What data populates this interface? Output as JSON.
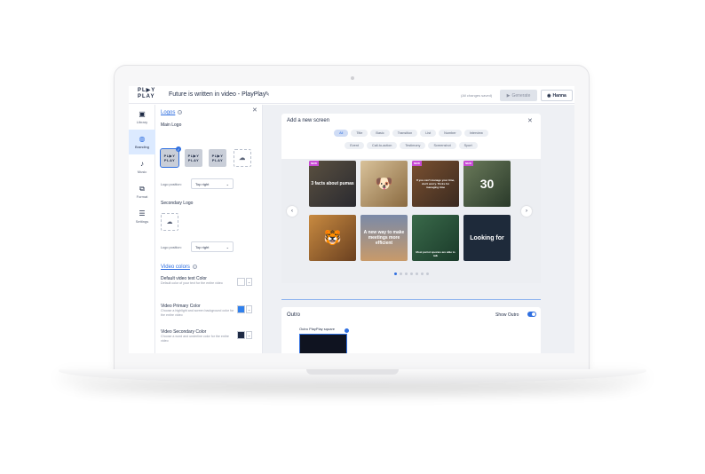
{
  "topbar": {
    "logo_top": "PL▶Y",
    "logo_bottom": "PLAY",
    "project_title": "Future is written in video - PlayPlay",
    "save_status": "(All changes saved)",
    "generate_label": "Generate",
    "user_name": "Hanna"
  },
  "nav": {
    "items": [
      {
        "label": "Library",
        "icon": "library-icon"
      },
      {
        "label": "Branding",
        "icon": "palette-icon"
      },
      {
        "label": "Music",
        "icon": "music-note-icon"
      },
      {
        "label": "Format",
        "icon": "format-icon"
      },
      {
        "label": "Settings",
        "icon": "sliders-icon"
      }
    ],
    "active": "Branding"
  },
  "panel": {
    "logos_title": "Logos",
    "main_logo_label": "Main Logo",
    "logo_tile_text": "PL▶Y PLAY",
    "logo_position_label": "Logo position:",
    "logo_position_value": "Top right",
    "secondary_logo_label": "Secondary Logo",
    "secondary_position_label": "Logo position:",
    "secondary_position_value": "Top right",
    "video_colors_title": "Video colors",
    "default_text_color_label": "Default video text Color",
    "default_text_color_desc": "Default color of your text for the entire video",
    "default_text_color": "#ffffff",
    "primary_color_label": "Video Primary Color",
    "primary_color_desc": "Choose a highlight and screen background color for the entire video",
    "primary_color": "#2f80ed",
    "secondary_color_label": "Video Secondary Color",
    "secondary_color_desc": "Choose a word and underline color for the entire video",
    "secondary_color": "#1e2a44"
  },
  "add_screen": {
    "title": "Add a new screen",
    "chips_row1": [
      "All",
      "Title",
      "Basic",
      "Transition",
      "List",
      "Number",
      "Interview"
    ],
    "chips_row2": [
      "Event",
      "Call-to-action",
      "Testimony",
      "Screenshot",
      "Sport"
    ],
    "active_chip": "All",
    "new_badge": "NEW",
    "templates": [
      {
        "text": "3 facts about pumas",
        "bg": "#3a3f4a"
      },
      {
        "text": "",
        "bg": "#b89a6e"
      },
      {
        "text": "If you can't manage your time, don't worry. Tricks for managing time",
        "bg": "#6b4a2a"
      },
      {
        "text": "30",
        "bg": "#4a5a3a"
      },
      {
        "text": "",
        "bg": "#8a5a2a"
      },
      {
        "text": "A new way to make meetings more efficient",
        "bg": "#5a6b8a"
      },
      {
        "text": "Most parrot species are able to talk",
        "bg": "#2f5a3a"
      },
      {
        "text": "Looking for",
        "bg": "#1e2a3a"
      }
    ],
    "pagination_count": 7,
    "pagination_active": 0
  },
  "outro": {
    "title": "Outro",
    "show_label": "Show Outro",
    "show_enabled": true,
    "screen_label": "Outro PlayPlay square"
  },
  "colors": {
    "accent": "#2f6fe0",
    "navy": "#1e2a44"
  }
}
